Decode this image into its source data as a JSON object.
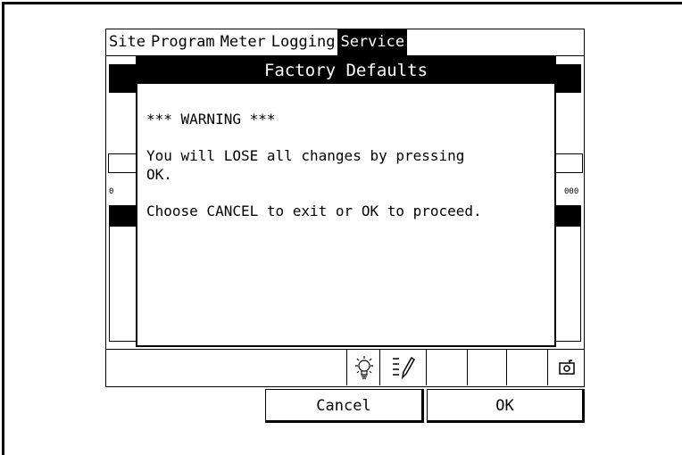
{
  "menubar": {
    "items": [
      {
        "label": "Site",
        "active": false
      },
      {
        "label": "Program",
        "active": false
      },
      {
        "label": "Meter",
        "active": false
      },
      {
        "label": "Logging",
        "active": false
      },
      {
        "label": "Service",
        "active": true
      }
    ]
  },
  "background": {
    "tick_left": "0",
    "tick_right": "000"
  },
  "dialog": {
    "title": "Factory Defaults",
    "warning": "*** WARNING ***",
    "message_1": "You will LOSE all changes by pressing OK.",
    "message_2": "Choose CANCEL to exit or OK to proceed."
  },
  "statusbar": {
    "icons": [
      "lightbulb-icon",
      "edit-list-icon",
      "camera-icon"
    ]
  },
  "buttons": {
    "cancel_label": "Cancel",
    "ok_label": "OK"
  }
}
